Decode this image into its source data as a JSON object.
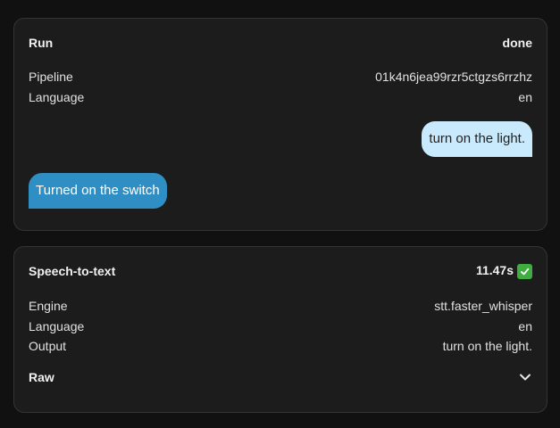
{
  "run": {
    "title": "Run",
    "status": "done",
    "pipeline_label": "Pipeline",
    "pipeline_value": "01k4n6jea99rzr5ctgzs6rrzhz",
    "language_label": "Language",
    "language_value": "en",
    "user_message": "turn on the light.",
    "assistant_message": "Turned on the switch"
  },
  "stt": {
    "title": "Speech-to-text",
    "duration": "11.47s",
    "status_icon": "check-mark-icon",
    "engine_label": "Engine",
    "engine_value": "stt.faster_whisper",
    "language_label": "Language",
    "language_value": "en",
    "output_label": "Output",
    "output_value": "turn on the light.",
    "raw_label": "Raw",
    "raw_icon": "chevron-down-icon"
  },
  "colors": {
    "background": "#111111",
    "card": "#1c1c1c",
    "user_bubble": "#c9eafc",
    "assistant_bubble": "#2f8fc4",
    "success": "#3fae3f"
  }
}
